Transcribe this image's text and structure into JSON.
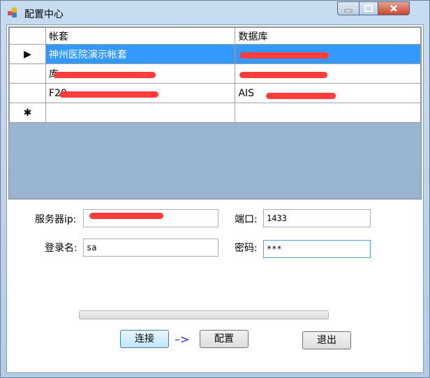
{
  "window": {
    "title": "配置中心"
  },
  "grid": {
    "columns": [
      "帐套",
      "数据库"
    ],
    "rows": [
      {
        "indicator": "▶",
        "account": "神州医院演示帐套",
        "database": ""
      },
      {
        "indicator": "",
        "account": "库",
        "database": ""
      },
      {
        "indicator": "",
        "account": "F20",
        "database": "AIS"
      },
      {
        "indicator": "✱",
        "account": "",
        "database": ""
      }
    ]
  },
  "form": {
    "server_label": "服务器ip:",
    "server_value": "",
    "port_label": "端口:",
    "port_value": "1433",
    "login_label": "登录名:",
    "login_value": "sa",
    "password_label": "密码:",
    "password_value": "***"
  },
  "buttons": {
    "connect": "连接",
    "arrow": "–>",
    "config": "配置",
    "exit": "退出"
  },
  "colors": {
    "selection": "#3399ff",
    "grid_bg": "#99b4d1",
    "redaction": "#ff3d3d"
  }
}
